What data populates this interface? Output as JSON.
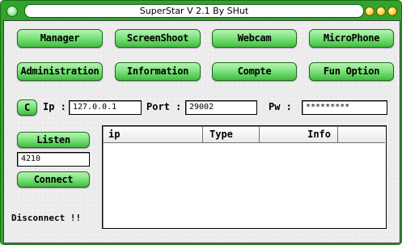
{
  "window": {
    "title": "SuperStar V 2.1 By SHut"
  },
  "nav": {
    "row1": [
      "Manager",
      "ScreenShoot",
      "Webcam",
      "MicroPhone"
    ],
    "row2": [
      "Administration",
      "Information",
      "Compte",
      "Fun Option"
    ]
  },
  "connection": {
    "c_button": "C",
    "ip_label": "Ip :",
    "ip_value": "127.0.0.1",
    "port_label": "Port :",
    "port_value": "29002",
    "pw_label": "Pw :",
    "pw_value": "*********"
  },
  "listen": {
    "listen_button": "Listen",
    "listen_port": "4210",
    "connect_button": "Connect"
  },
  "table": {
    "columns": [
      "ip",
      "Type",
      "Info",
      ""
    ],
    "rows": []
  },
  "status": {
    "text": "Disconnect !!"
  },
  "colors": {
    "frame": "#2fa52b",
    "button": "#5ccf5a",
    "window_controls": "#f4d23a"
  },
  "icons": {
    "system_menu": "green-orb-icon",
    "minimize": "yellow-orb-icon",
    "maximize": "yellow-orb-icon",
    "close": "yellow-orb-icon"
  }
}
